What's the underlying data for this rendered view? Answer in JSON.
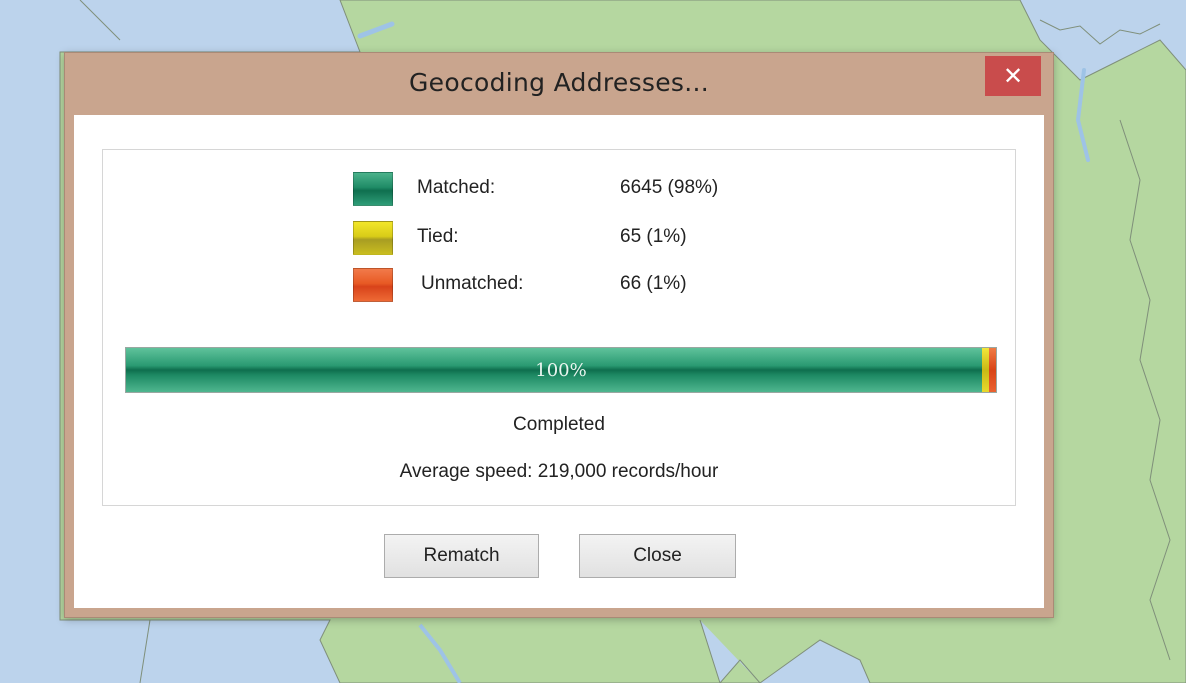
{
  "dialog": {
    "title": "Geocoding Addresses...",
    "close_icon": "close-icon",
    "close_glyph": "✕"
  },
  "legend": [
    {
      "label": "Matched:",
      "value": "6645 (98%)",
      "color": "#1f8b66"
    },
    {
      "label": "Tied:",
      "value": "65 (1%)",
      "color": "#d9cc18"
    },
    {
      "label": "Unmatched:",
      "value": "66 (1%)",
      "color": "#e85a24"
    }
  ],
  "progress": {
    "label": "100%",
    "percent": 100,
    "matched_fraction": 0.983,
    "tied_fraction": 0.0085,
    "unmatched_fraction": 0.0085
  },
  "status": "Completed",
  "speed": "Average speed: 219,000 records/hour",
  "buttons": {
    "rematch": "Rematch",
    "close": "Close"
  },
  "colors": {
    "map_water": "#bcd3ec",
    "map_land": "#b5d7a0",
    "dialog_frame": "#c9a58e",
    "close_button": "#c94c4c"
  }
}
